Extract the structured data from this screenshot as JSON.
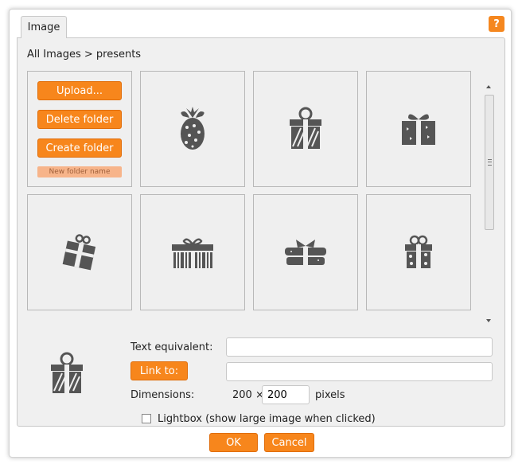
{
  "dialog": {
    "tab_label": "Image",
    "help_label": "?"
  },
  "breadcrumb": "All Images > presents",
  "actions": {
    "upload_label": "Upload...",
    "delete_folder_label": "Delete folder",
    "create_folder_label": "Create folder",
    "new_folder_placeholder": "New folder name"
  },
  "images": [
    {
      "icon": "pineapple-gift-icon"
    },
    {
      "icon": "striped-gift-box-icon"
    },
    {
      "icon": "butterfly-gift-box-icon"
    },
    {
      "icon": "tilted-gift-box-icon"
    },
    {
      "icon": "barcode-gift-box-icon"
    },
    {
      "icon": "flat-gift-box-icon"
    },
    {
      "icon": "flower-gift-box-icon"
    }
  ],
  "form": {
    "text_equivalent_label": "Text equivalent:",
    "text_equivalent_value": "",
    "link_to_label": "Link to:",
    "link_to_value": "",
    "dimensions_label": "Dimensions:",
    "width_text": "200 ×",
    "height_value": "200",
    "pixels_label": "pixels",
    "lightbox_label": "Lightbox (show large image when clicked)",
    "lightbox_checked": false
  },
  "footer": {
    "ok_label": "OK",
    "cancel_label": "Cancel"
  },
  "colors": {
    "accent": "#f7861c",
    "panel": "#f0f0f0",
    "icon": "#555555"
  }
}
